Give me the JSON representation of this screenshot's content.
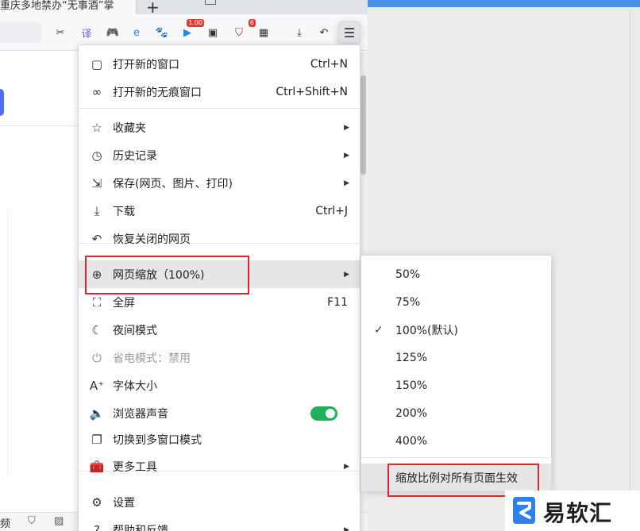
{
  "tab": {
    "title": "重庆多地禁办“无事酒”掌"
  },
  "toolbar": {
    "icons": [
      {
        "name": "scissors-icon",
        "glyph": "✂",
        "color": "#444444"
      },
      {
        "name": "translate-icon",
        "glyph": "译",
        "color": "#7a5cd6"
      },
      {
        "name": "game-icon",
        "glyph": "🎮",
        "color": "#e57a2c"
      },
      {
        "name": "ie-icon",
        "glyph": "e",
        "color": "#2f7fd8"
      },
      {
        "name": "paw-icon",
        "glyph": "🐾",
        "color": "#e0a800"
      },
      {
        "name": "player-icon",
        "glyph": "▶",
        "color": "#1e88e5"
      },
      {
        "name": "reader-icon",
        "glyph": "▣",
        "color": "#333333"
      },
      {
        "name": "ublock-icon",
        "glyph": "⛉",
        "color": "#b71c1c"
      },
      {
        "name": "apps-grid-icon",
        "glyph": "▦",
        "color": "#333333"
      },
      {
        "name": "download-icon",
        "glyph": "⤓",
        "color": "#333333"
      },
      {
        "name": "undo-icon",
        "glyph": "↶",
        "color": "#333333"
      }
    ],
    "badge_player": "1.00",
    "badge_ublock": "6",
    "menu_icon": "☰"
  },
  "menu": {
    "items": [
      {
        "label": "打开新的窗口",
        "shortcut": "Ctrl+N",
        "icon": "▢"
      },
      {
        "label": "打开新的无痕窗口",
        "shortcut": "Ctrl+Shift+N",
        "icon": "∞"
      },
      {
        "label": "收藏夹",
        "shortcut": "",
        "icon": "☆"
      },
      {
        "label": "历史记录",
        "shortcut": "",
        "icon": "◷"
      },
      {
        "label": "保存(网页、图片、打印)",
        "shortcut": "",
        "icon": "⇲"
      },
      {
        "label": "下载",
        "shortcut": "Ctrl+J",
        "icon": "⤓"
      },
      {
        "label": "恢复关闭的网页",
        "shortcut": "",
        "icon": "↶"
      },
      {
        "label": "网页缩放（100%)",
        "shortcut": "",
        "icon": "⊕"
      },
      {
        "label": "全屏",
        "shortcut": "F11",
        "icon": "⛶"
      },
      {
        "label": "夜间模式",
        "shortcut": "",
        "icon": "☾"
      },
      {
        "label": "省电模式：禁用",
        "shortcut": "",
        "icon": "⏻"
      },
      {
        "label": "字体大小",
        "shortcut": "",
        "icon": "A⁺"
      },
      {
        "label": "浏览器声音",
        "shortcut": "",
        "icon": "🔈"
      },
      {
        "label": "切换到多窗口模式",
        "shortcut": "",
        "icon": "❐"
      },
      {
        "label": "更多工具",
        "shortcut": "",
        "icon": "🧰"
      },
      {
        "label": "设置",
        "shortcut": "",
        "icon": "⚙"
      },
      {
        "label": "帮助和反馈",
        "shortcut": "",
        "icon": "?"
      }
    ],
    "sound_enabled": true
  },
  "zoom_submenu": {
    "options": [
      "50%",
      "75%",
      "100%(默认)",
      "125%",
      "150%",
      "200%",
      "400%"
    ],
    "selected": "100%(默认)",
    "apply_all": "缩放比例对所有页面生效"
  },
  "statusbar": {
    "text": "频"
  },
  "watermark": {
    "text": "易软汇"
  },
  "colors": {
    "accent": "#4a8fe8",
    "toggle_on": "#21b05a",
    "highlight": "#d9272e"
  }
}
